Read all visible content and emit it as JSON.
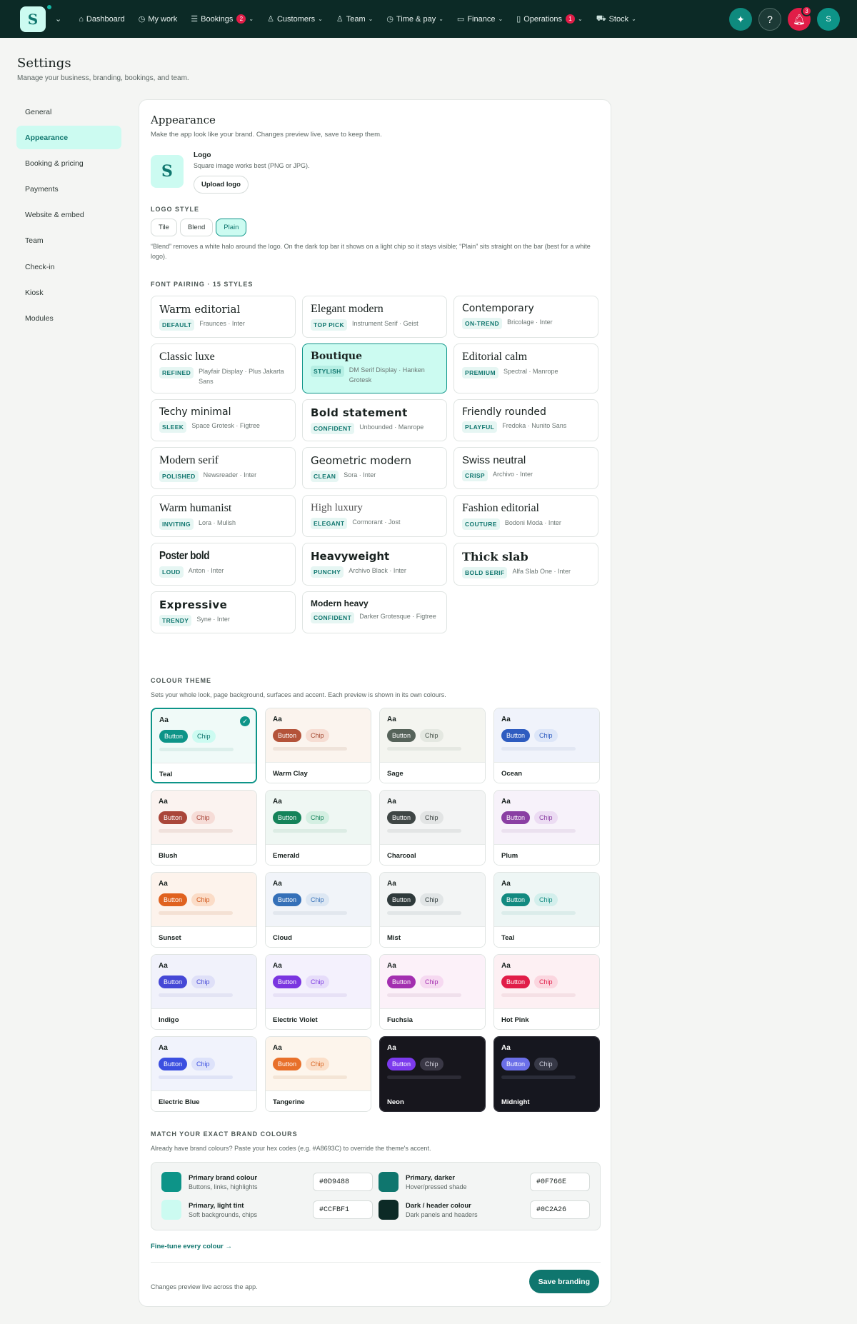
{
  "nav": {
    "logo_letter": "S",
    "items": [
      {
        "label": "Dashboard",
        "icon": "home-icon",
        "glyph": "⌂",
        "chevron": false,
        "badge": ""
      },
      {
        "label": "My work",
        "icon": "clock-icon",
        "glyph": "◷",
        "chevron": false,
        "badge": ""
      },
      {
        "label": "Bookings",
        "icon": "list-icon",
        "glyph": "☰",
        "chevron": true,
        "badge": "2"
      },
      {
        "label": "Customers",
        "icon": "users-icon",
        "glyph": "♙",
        "chevron": true,
        "badge": ""
      },
      {
        "label": "Team",
        "icon": "team-icon",
        "glyph": "♙",
        "chevron": true,
        "badge": ""
      },
      {
        "label": "Time & pay",
        "icon": "clock-icon",
        "glyph": "◷",
        "chevron": true,
        "badge": ""
      },
      {
        "label": "Finance",
        "icon": "card-icon",
        "glyph": "▭",
        "chevron": true,
        "badge": ""
      },
      {
        "label": "Operations",
        "icon": "clipboard-icon",
        "glyph": "▯",
        "chevron": true,
        "badge": "1"
      },
      {
        "label": "Stock",
        "icon": "cart-icon",
        "glyph": "⛟",
        "chevron": true,
        "badge": ""
      }
    ],
    "notifications_count": "3",
    "avatar_letter": "S"
  },
  "page": {
    "title": "Settings",
    "subtitle": "Manage your business, branding, bookings, and team."
  },
  "sidebar": {
    "items": [
      "General",
      "Appearance",
      "Booking & pricing",
      "Payments",
      "Website & embed",
      "Team",
      "Check-in",
      "Kiosk",
      "Modules"
    ],
    "active": "Appearance"
  },
  "appearance": {
    "title": "Appearance",
    "subtitle": "Make the app look like your brand. Changes preview live, save to keep them.",
    "logo": {
      "letter": "S",
      "label": "Logo",
      "hint": "Square image works best (PNG or JPG).",
      "upload_label": "Upload logo"
    },
    "logo_style": {
      "heading": "LOGO STYLE",
      "options": [
        "Tile",
        "Blend",
        "Plain"
      ],
      "selected": "Plain",
      "note": "“Blend” removes a white halo around the logo. On the dark top bar it shows on a light chip so it stays visible; “Plain” sits straight on the bar (best for a white logo)."
    },
    "font_pairing": {
      "heading": "FONT PAIRING · 15 STYLES",
      "selected": "Boutique",
      "items": [
        {
          "name": "Warm editorial",
          "tag": "DEFAULT",
          "fonts": "Fraunces · Inter"
        },
        {
          "name": "Elegant modern",
          "tag": "TOP PICK",
          "fonts": "Instrument Serif · Geist"
        },
        {
          "name": "Contemporary",
          "tag": "ON-TREND",
          "fonts": "Bricolage · Inter"
        },
        {
          "name": "Classic luxe",
          "tag": "REFINED",
          "fonts": "Playfair Display · Plus Jakarta Sans"
        },
        {
          "name": "Boutique",
          "tag": "STYLISH",
          "fonts": "DM Serif Display · Hanken Grotesk"
        },
        {
          "name": "Editorial calm",
          "tag": "PREMIUM",
          "fonts": "Spectral · Manrope"
        },
        {
          "name": "Techy minimal",
          "tag": "SLEEK",
          "fonts": "Space Grotesk · Figtree"
        },
        {
          "name": "Bold statement",
          "tag": "CONFIDENT",
          "fonts": "Unbounded · Manrope"
        },
        {
          "name": "Friendly rounded",
          "tag": "PLAYFUL",
          "fonts": "Fredoka · Nunito Sans"
        },
        {
          "name": "Modern serif",
          "tag": "POLISHED",
          "fonts": "Newsreader · Inter"
        },
        {
          "name": "Geometric modern",
          "tag": "CLEAN",
          "fonts": "Sora · Inter"
        },
        {
          "name": "Swiss neutral",
          "tag": "CRISP",
          "fonts": "Archivo · Inter"
        },
        {
          "name": "Warm humanist",
          "tag": "INVITING",
          "fonts": "Lora · Mulish"
        },
        {
          "name": "High luxury",
          "tag": "ELEGANT",
          "fonts": "Cormorant · Jost"
        },
        {
          "name": "Fashion editorial",
          "tag": "COUTURE",
          "fonts": "Bodoni Moda · Inter"
        },
        {
          "name": "Poster bold",
          "tag": "LOUD",
          "fonts": "Anton · Inter"
        },
        {
          "name": "Heavyweight",
          "tag": "PUNCHY",
          "fonts": "Archivo Black · Inter"
        },
        {
          "name": "Thick slab",
          "tag": "BOLD SERIF",
          "fonts": "Alfa Slab One · Inter"
        },
        {
          "name": "Expressive",
          "tag": "TRENDY",
          "fonts": "Syne · Inter"
        },
        {
          "name": "Modern heavy",
          "tag": "CONFIDENT",
          "fonts": "Darker Grotesque · Figtree"
        }
      ]
    },
    "colour_theme": {
      "heading": "COLOUR THEME",
      "subtitle": "Sets your whole look, page background, surfaces and accent. Each preview is shown in its own colours.",
      "selected": "Teal",
      "preview_text": "Aa",
      "button_label": "Button",
      "chip_label": "Chip",
      "themes": [
        {
          "name": "Teal",
          "bg": "#f0faf8",
          "accent": "#0d9488",
          "chip_bg": "#ccfbf1",
          "chip_fg": "#0f766e",
          "bar": "#dcefeb",
          "text": "#18211f"
        },
        {
          "name": "Warm Clay",
          "bg": "#fbf4ee",
          "accent": "#b4533a",
          "chip_bg": "#f6ddd3",
          "chip_fg": "#a3472f",
          "bar": "#efe3da",
          "text": "#18211f"
        },
        {
          "name": "Sage",
          "bg": "#f4f5f0",
          "accent": "#56635a",
          "chip_bg": "#e4e8e1",
          "chip_fg": "#4b574e",
          "bar": "#e5e8e2",
          "text": "#18211f"
        },
        {
          "name": "Ocean",
          "bg": "#f0f3fb",
          "accent": "#2e5cc0",
          "chip_bg": "#dde6f8",
          "chip_fg": "#2e5cc0",
          "bar": "#e2e7f3",
          "text": "#18211f"
        },
        {
          "name": "Blush",
          "bg": "#fbf3f0",
          "accent": "#a9463a",
          "chip_bg": "#f6dcd7",
          "chip_fg": "#a9463a",
          "bar": "#f0e1dc",
          "text": "#18211f"
        },
        {
          "name": "Emerald",
          "bg": "#eff7f3",
          "accent": "#15835a",
          "chip_bg": "#d4efe2",
          "chip_fg": "#15835a",
          "bar": "#dcece4",
          "text": "#18211f"
        },
        {
          "name": "Charcoal",
          "bg": "#f3f4f4",
          "accent": "#3f4645",
          "chip_bg": "#e2e4e4",
          "chip_fg": "#3f4645",
          "bar": "#e3e5e5",
          "text": "#18211f"
        },
        {
          "name": "Plum",
          "bg": "#f7f2fa",
          "accent": "#8a3fa3",
          "chip_bg": "#ecdcf3",
          "chip_fg": "#8a3fa3",
          "bar": "#ebe1ef",
          "text": "#18211f"
        },
        {
          "name": "Sunset",
          "bg": "#fdf3ec",
          "accent": "#e0621f",
          "chip_bg": "#fbdcc7",
          "chip_fg": "#d0561a",
          "bar": "#f4e1d4",
          "text": "#18211f"
        },
        {
          "name": "Cloud",
          "bg": "#f1f4f9",
          "accent": "#3570b8",
          "chip_bg": "#dde7f3",
          "chip_fg": "#3570b8",
          "bar": "#e2e7ee",
          "text": "#18211f"
        },
        {
          "name": "Mist",
          "bg": "#f3f5f5",
          "accent": "#2f3a3b",
          "chip_bg": "#e1e5e6",
          "chip_fg": "#2f3a3b",
          "bar": "#e2e6e7",
          "text": "#18211f"
        },
        {
          "name": "Teal",
          "bg": "#eef6f5",
          "accent": "#128a80",
          "chip_bg": "#d3efec",
          "chip_fg": "#128a80",
          "bar": "#dbecea",
          "text": "#18211f"
        },
        {
          "name": "Indigo",
          "bg": "#f1f2fb",
          "accent": "#4548d6",
          "chip_bg": "#dfe0f8",
          "chip_fg": "#4548d6",
          "bar": "#e3e4f4",
          "text": "#18211f"
        },
        {
          "name": "Electric Violet",
          "bg": "#f4f1fd",
          "accent": "#7a35e0",
          "chip_bg": "#e6dcfa",
          "chip_fg": "#7a35e0",
          "bar": "#e7e1f6",
          "text": "#18211f"
        },
        {
          "name": "Fuchsia",
          "bg": "#fcf1f9",
          "accent": "#a32fb0",
          "chip_bg": "#f6d9f1",
          "chip_fg": "#a32fb0",
          "bar": "#f0e0ec",
          "text": "#18211f"
        },
        {
          "name": "Hot Pink",
          "bg": "#fdf0f3",
          "accent": "#e11d48",
          "chip_bg": "#fbd6df",
          "chip_fg": "#e11d48",
          "bar": "#f5e0e5",
          "text": "#18211f"
        },
        {
          "name": "Electric Blue",
          "bg": "#f1f3fc",
          "accent": "#3b4fe0",
          "chip_bg": "#dde2fa",
          "chip_fg": "#3b4fe0",
          "bar": "#dfe3f6",
          "text": "#18211f"
        },
        {
          "name": "Tangerine",
          "bg": "#fdf5ec",
          "accent": "#e8702a",
          "chip_bg": "#fbdfc9",
          "chip_fg": "#d8621f",
          "bar": "#f4e5d6",
          "text": "#18211f"
        },
        {
          "name": "Neon",
          "bg": "#17161d",
          "accent": "#7c3aed",
          "chip_bg": "#3a3846",
          "chip_fg": "#d4d2de",
          "bar": "#2c2b35",
          "text": "#ffffff",
          "label_bg": "#17161d"
        },
        {
          "name": "Midnight",
          "bg": "#16171f",
          "accent": "#6b6fe8",
          "chip_bg": "#363846",
          "chip_fg": "#cfd1de",
          "bar": "#2a2c38",
          "text": "#ffffff",
          "label_bg": "#16171f"
        }
      ]
    },
    "brand_colours": {
      "heading": "MATCH YOUR EXACT BRAND COLOURS",
      "subtitle": "Already have brand colours? Paste your hex codes (e.g. #A8693C) to override the theme's accent.",
      "primary": {
        "label": "Primary brand colour",
        "hint": "Buttons, links, highlights",
        "hex": "#0D9488"
      },
      "primary_dark": {
        "label": "Primary, darker",
        "hint": "Hover/pressed shade",
        "hex": "#0F766E"
      },
      "primary_light": {
        "label": "Primary, light tint",
        "hint": "Soft backgrounds, chips",
        "hex": "#CCFBF1"
      },
      "header": {
        "label": "Dark / header colour",
        "hint": "Dark panels and headers",
        "hex": "#0C2A26"
      },
      "fine_tune_link": "Fine-tune every colour →"
    },
    "footer": {
      "note": "Changes preview live across the app.",
      "save_label": "Save branding"
    }
  }
}
